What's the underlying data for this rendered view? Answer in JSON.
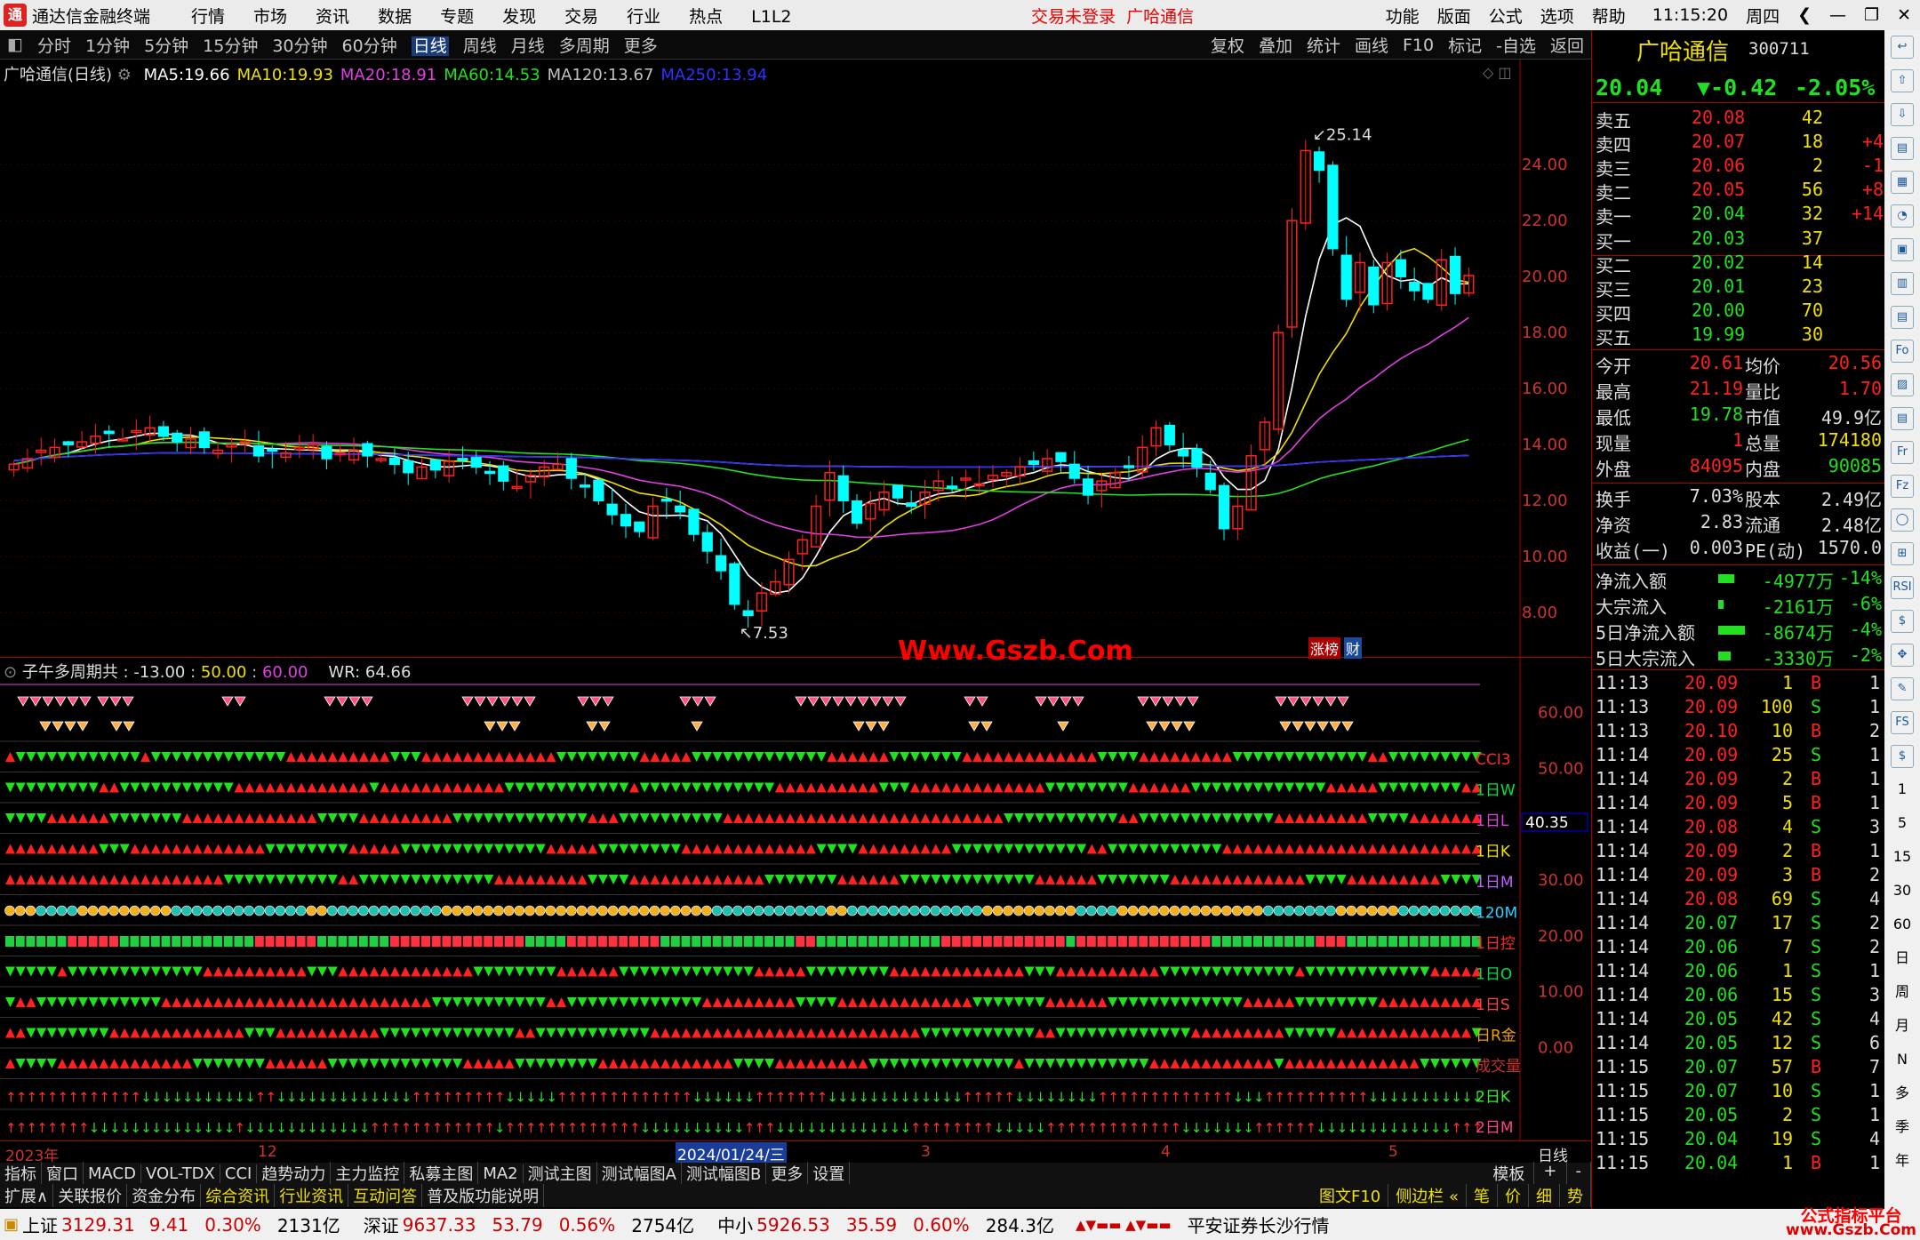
{
  "app": {
    "title": "通达信金融终端",
    "menu": [
      "行情",
      "市场",
      "资讯",
      "数据",
      "专题",
      "发现",
      "交易",
      "行业",
      "热点",
      "L1L2"
    ],
    "login": "交易未登录",
    "stock_tag": "广哈通信",
    "right_menu": [
      "功能",
      "版面",
      "公式",
      "选项",
      "帮助"
    ],
    "time": "11:15:20",
    "weekday": "周四"
  },
  "periods": [
    "分时",
    "1分钟",
    "5分钟",
    "15分钟",
    "30分钟",
    "60分钟",
    "日线",
    "周线",
    "月线",
    "多周期",
    "更多"
  ],
  "active_period": "日线",
  "chart_tools": [
    "复权",
    "叠加",
    "统计",
    "画线",
    "F10",
    "标记",
    "-自选",
    "返回"
  ],
  "main": {
    "label": "广哈通信(日线)",
    "ma": [
      {
        "n": "MA5:",
        "v": "19.66",
        "c": "#ffffff"
      },
      {
        "n": "MA10:",
        "v": "19.93",
        "c": "#f0e000"
      },
      {
        "n": "MA20:",
        "v": "18.91",
        "c": "#e040e0"
      },
      {
        "n": "MA60:",
        "v": "14.53",
        "c": "#20e020"
      },
      {
        "n": "MA120:",
        "v": "13.67",
        "c": "#c0c0c0"
      },
      {
        "n": "MA250:",
        "v": "13.94",
        "c": "#3030ff"
      }
    ],
    "high_label": "25.14",
    "low_label": "7.53",
    "watermark": "Www.Gszb.Com",
    "badge1": "涨榜",
    "badge2": "财"
  },
  "chart_data": [
    {
      "type": "candlestick",
      "title": "广哈通信(日线)",
      "ylim": [
        6.8,
        26.8
      ],
      "yticks": [
        8,
        10,
        12,
        14,
        16,
        18,
        20,
        22,
        24
      ],
      "ytick_labels": [
        "8.00",
        "10.00",
        "12.00",
        "14.00",
        "16.00",
        "18.00",
        "20.00",
        "22.00",
        "24.00"
      ],
      "closes": [
        13.3,
        13.5,
        13.8,
        13.9,
        14.0,
        14.1,
        14.3,
        14.4,
        14.2,
        14.5,
        14.6,
        14.3,
        14.1,
        14.2,
        13.9,
        13.8,
        14.0,
        14.1,
        13.6,
        13.8,
        13.7,
        13.9,
        14.0,
        13.5,
        13.7,
        13.8,
        13.6,
        13.5,
        13.3,
        13.0,
        13.2,
        13.1,
        13.4,
        13.5,
        13.2,
        13.0,
        12.7,
        12.5,
        12.9,
        13.2,
        13.3,
        12.8,
        12.5,
        12.0,
        11.5,
        11.1,
        10.9,
        11.8,
        12.0,
        11.6,
        10.8,
        10.2,
        9.5,
        8.3,
        7.9,
        8.7,
        9.1,
        9.9,
        10.6,
        11.8,
        13.0,
        12.0,
        11.2,
        11.9,
        12.3,
        12.1,
        11.8,
        12.3,
        12.7,
        12.5,
        12.8,
        12.6,
        12.9,
        13.0,
        13.2,
        13.3,
        13.5,
        13.4,
        12.8,
        12.2,
        12.7,
        13.0,
        13.2,
        13.9,
        14.6,
        14.0,
        13.6,
        13.2,
        12.4,
        11.0,
        11.8,
        13.6,
        14.8,
        18.0,
        22.0,
        24.5,
        23.8,
        21.0,
        19.2,
        20.5,
        19.0,
        20.5,
        20.0,
        19.5,
        19.2,
        20.6,
        19.4,
        20.04
      ],
      "ma_series": [
        "MA5",
        "MA10",
        "MA20",
        "MA60",
        "MA120",
        "MA250"
      ]
    },
    {
      "type": "signal_grid",
      "title": "子午多周期共",
      "params": [
        "-13.00",
        "50.00",
        "60.00"
      ],
      "wr": "WR: 64.66",
      "ylim": [
        -5,
        65
      ],
      "yticks": [
        0,
        10,
        20,
        30,
        40,
        50,
        60
      ],
      "ytick_labels": [
        "0.00",
        "10.00",
        "20.00",
        "30.00",
        "40.00",
        "50.00",
        "60.00"
      ],
      "current_value": "40.35"
    }
  ],
  "sub": {
    "title": "子午多周期共 :",
    "p1": "-13.00",
    "p2": "50.00",
    "p3": "60.00",
    "wr": "WR: 64.66",
    "cur": "40.35",
    "rows": [
      "CCI3",
      "1日W",
      "1日L",
      "1日K",
      "1日M",
      "120M",
      "1日控",
      "1日O",
      "1日S",
      "日R金",
      "成交量",
      "2日K",
      "2日M"
    ]
  },
  "dates": [
    "2023年",
    "12",
    "2024/01/24/三",
    "3",
    "4",
    "5"
  ],
  "period_badge": "日线",
  "tabs1": [
    "指标",
    "窗口",
    "MACD",
    "VOL-TDX",
    "CCI",
    "趋势动力",
    "主力监控",
    "私募主图",
    "MA2",
    "测试主图",
    "测试幅图A",
    "测试幅图B",
    "更多",
    "设置"
  ],
  "tabs1_right": [
    "模板",
    "+",
    "-"
  ],
  "tabs2": [
    "扩展∧",
    "关联报价",
    "资金分布",
    "综合资讯",
    "行业资讯",
    "互动问答",
    "普及版功能说明"
  ],
  "tabs2_right": [
    "图文F10",
    "侧边栏 «",
    "笔",
    "价",
    "细",
    "势"
  ],
  "quote": {
    "name": "广哈通信",
    "code": "300711",
    "price": "20.04",
    "change": "▼-0.42",
    "pct": "-2.05%",
    "asks": [
      [
        "卖五",
        "20.08",
        "42",
        ""
      ],
      [
        "卖四",
        "20.07",
        "18",
        "+4"
      ],
      [
        "卖三",
        "20.06",
        "2",
        "-1"
      ],
      [
        "卖二",
        "20.05",
        "56",
        "+8"
      ],
      [
        "卖一",
        "20.04",
        "32",
        "+14"
      ]
    ],
    "bids": [
      [
        "买一",
        "20.03",
        "37",
        ""
      ],
      [
        "买二",
        "20.02",
        "14",
        ""
      ],
      [
        "买三",
        "20.01",
        "23",
        ""
      ],
      [
        "买四",
        "20.00",
        "70",
        ""
      ],
      [
        "买五",
        "19.99",
        "30",
        ""
      ]
    ],
    "stats": [
      [
        "今开",
        "20.61",
        "均价",
        "20.56"
      ],
      [
        "最高",
        "21.19",
        "量比",
        "1.70"
      ],
      [
        "最低",
        "19.78",
        "市值",
        "49.9亿"
      ],
      [
        "现量",
        "1",
        "总量",
        "174180"
      ],
      [
        "外盘",
        "84095",
        "内盘",
        "90085"
      ]
    ],
    "stats2": [
      [
        "换手",
        "7.03%",
        "股本",
        "2.49亿"
      ],
      [
        "净资",
        "2.83",
        "流通",
        "2.48亿"
      ],
      [
        "收益(一)",
        "0.003",
        "PE(动)",
        "1570.0"
      ]
    ],
    "flows": [
      [
        "净流入额",
        "-4977万",
        "-14%"
      ],
      [
        "大宗流入",
        "-2161万",
        "-6%"
      ],
      [
        "5日净流入额",
        "-8674万",
        "-4%"
      ],
      [
        "5日大宗流入",
        "-3330万",
        "-2%"
      ]
    ],
    "ticks": [
      [
        "11:13",
        "20.09",
        "1",
        "B",
        "1"
      ],
      [
        "11:13",
        "20.09",
        "100",
        "S",
        "1"
      ],
      [
        "11:13",
        "20.10",
        "10",
        "B",
        "2"
      ],
      [
        "11:14",
        "20.09",
        "25",
        "S",
        "1"
      ],
      [
        "11:14",
        "20.09",
        "2",
        "B",
        "1"
      ],
      [
        "11:14",
        "20.09",
        "5",
        "B",
        "1"
      ],
      [
        "11:14",
        "20.08",
        "4",
        "S",
        "3"
      ],
      [
        "11:14",
        "20.09",
        "2",
        "B",
        "1"
      ],
      [
        "11:14",
        "20.09",
        "3",
        "B",
        "2"
      ],
      [
        "11:14",
        "20.08",
        "69",
        "S",
        "4"
      ],
      [
        "11:14",
        "20.07",
        "17",
        "S",
        "2"
      ],
      [
        "11:14",
        "20.06",
        "7",
        "S",
        "2"
      ],
      [
        "11:14",
        "20.06",
        "1",
        "S",
        "1"
      ],
      [
        "11:14",
        "20.06",
        "15",
        "S",
        "3"
      ],
      [
        "11:14",
        "20.05",
        "42",
        "S",
        "4"
      ],
      [
        "11:14",
        "20.05",
        "12",
        "S",
        "6"
      ],
      [
        "11:15",
        "20.07",
        "57",
        "B",
        "7"
      ],
      [
        "11:15",
        "20.07",
        "10",
        "S",
        "1"
      ],
      [
        "11:15",
        "20.05",
        "2",
        "S",
        "1"
      ],
      [
        "11:15",
        "20.04",
        "19",
        "S",
        "4"
      ],
      [
        "11:15",
        "20.04",
        "1",
        "B",
        "1"
      ]
    ]
  },
  "sidebar_labels": [
    "1",
    "5",
    "15",
    "30",
    "60",
    "日",
    "周",
    "月",
    "N",
    "多",
    "季",
    "年"
  ],
  "status": {
    "sh_name": "上证",
    "sh": "3129.31",
    "sh_ch": "9.41",
    "sh_pct": "0.30%",
    "sh_amt": "2131亿",
    "sz_name": "深证",
    "sz": "9637.33",
    "sz_ch": "53.79",
    "sz_pct": "0.56%",
    "sz_amt": "2754亿",
    "zx_name": "中小",
    "zx": "5926.53",
    "zx_ch": "35.59",
    "zx_pct": "0.60%",
    "zx_amt": "284.3亿",
    "broker": "平安证券长沙行情",
    "brand": "公式指标平台",
    "brand_url": "www.Gszb.Com"
  }
}
